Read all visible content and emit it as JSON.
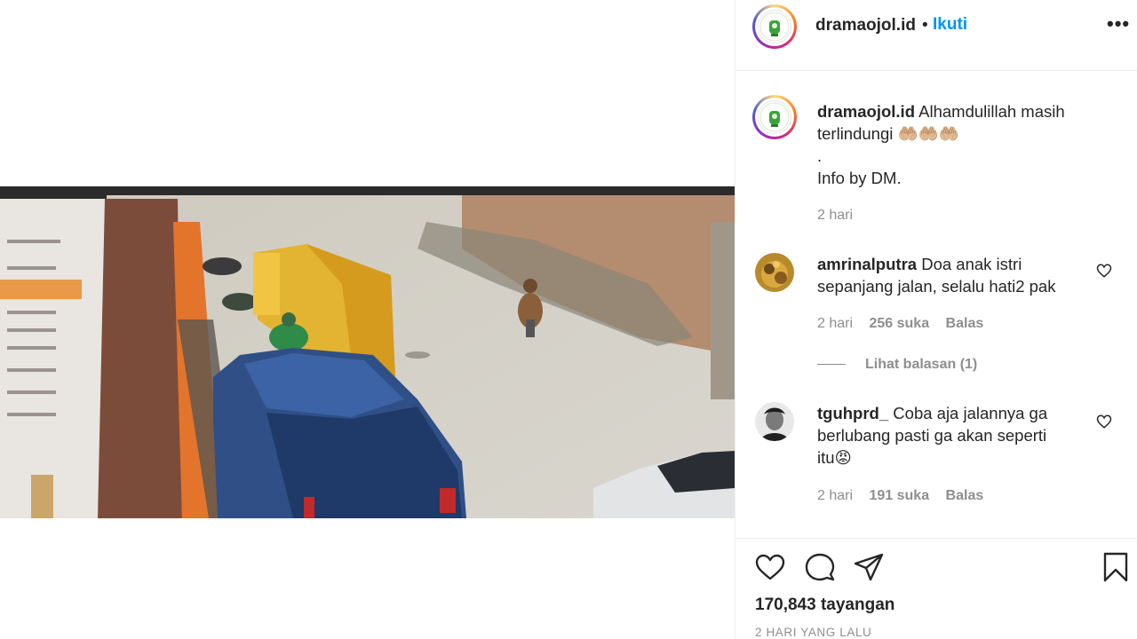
{
  "post": {
    "username": "dramaojol.id",
    "follow_label": "Ikuti",
    "dot": "•",
    "more_label": "•••"
  },
  "caption": {
    "username": "dramaojol.id",
    "line1": "Alhamdulillah masih",
    "line2": "terlindungi 🤲🏼🤲🏼🤲🏼",
    "line3": ".",
    "line4": "Info by DM.",
    "time": "2 hari"
  },
  "comments": [
    {
      "username": "amrinalputra",
      "line1": "Doa anak istri",
      "line2": "sepanjang jalan, selalu hati2 pak",
      "time": "2 hari",
      "likes": "256 suka",
      "reply_label": "Balas",
      "view_replies": "Lihat balasan (1)"
    },
    {
      "username": "tguhprd_",
      "line1": "Coba aja jalannya ga",
      "line2": "berlubang pasti ga akan seperti",
      "line3": "itu😡",
      "time": "2 hari",
      "likes": "191 suka",
      "reply_label": "Balas"
    }
  ],
  "actions": {
    "like_icon": "heart-icon",
    "comment_icon": "comment-icon",
    "share_icon": "share-icon",
    "save_icon": "bookmark-icon"
  },
  "stats": {
    "views": "170,843 tayangan",
    "timestamp": "2 HARI YANG LALU"
  },
  "colors": {
    "accent": "#0095f6",
    "muted": "#8e8e8e",
    "text": "#262626",
    "border": "#efefef"
  }
}
